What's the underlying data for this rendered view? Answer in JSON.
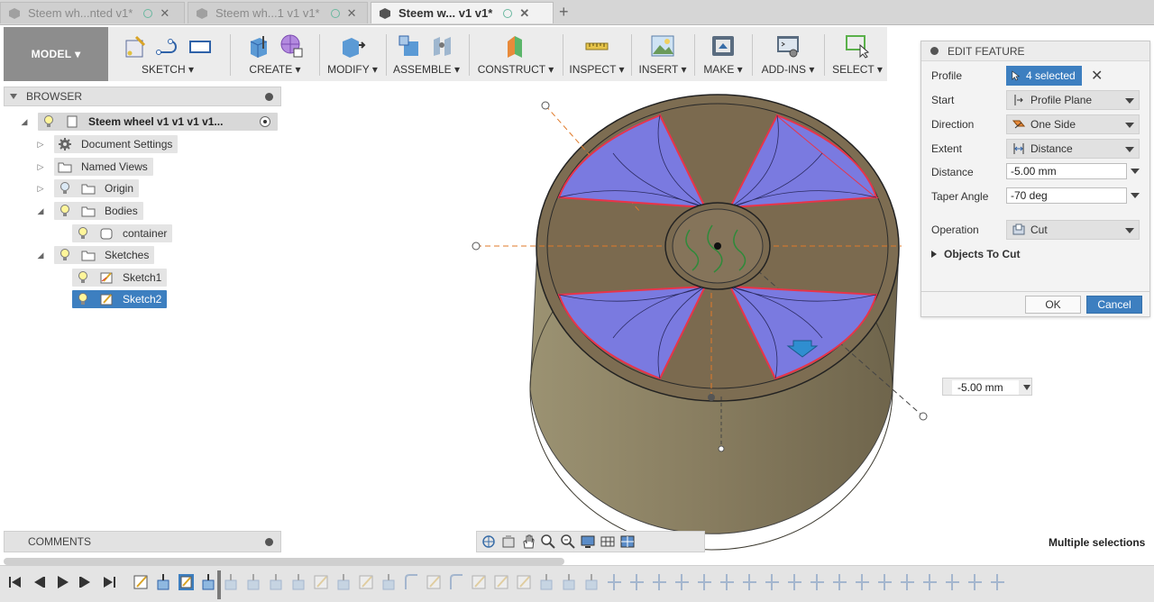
{
  "tabs": [
    {
      "label": "Steem wh...nted v1*",
      "active": false
    },
    {
      "label": "Steem wh...1 v1 v1*",
      "active": false
    },
    {
      "label": "Steem w... v1 v1*",
      "active": true
    }
  ],
  "toolbar": {
    "model_label": "MODEL",
    "groups": [
      "SKETCH",
      "CREATE",
      "MODIFY",
      "ASSEMBLE",
      "CONSTRUCT",
      "INSPECT",
      "INSERT",
      "MAKE",
      "ADD-INS",
      "SELECT"
    ]
  },
  "browser": {
    "title": "BROWSER",
    "root": "Steem wheel v1 v1 v1 v1...",
    "items": [
      "Document Settings",
      "Named Views",
      "Origin",
      "Bodies",
      "container",
      "Sketches",
      "Sketch1",
      "Sketch2"
    ]
  },
  "comments": {
    "title": "COMMENTS"
  },
  "edit_feature": {
    "title": "EDIT FEATURE",
    "profile_label": "Profile",
    "profile_value": "4 selected",
    "start_label": "Start",
    "start_value": "Profile Plane",
    "direction_label": "Direction",
    "direction_value": "One Side",
    "extent_label": "Extent",
    "extent_value": "Distance",
    "distance_label": "Distance",
    "distance_value": "-5.00 mm",
    "taper_label": "Taper Angle",
    "taper_value": "-70 deg",
    "operation_label": "Operation",
    "operation_value": "Cut",
    "objects_label": "Objects To Cut",
    "ok_label": "OK",
    "cancel_label": "Cancel"
  },
  "dimension_input": "-5.00 mm",
  "status": "Multiple selections",
  "colors": {
    "accent": "#3d7fc0",
    "profile_fill": "#6f6fd8",
    "body": "#8a7e62",
    "cap": "#7a6a50",
    "selection_edge": "#e8344a"
  }
}
